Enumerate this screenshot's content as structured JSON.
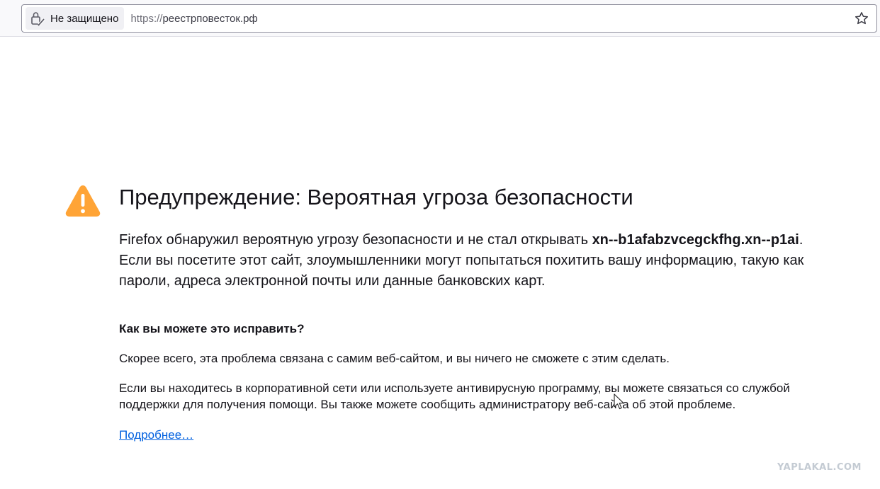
{
  "browser": {
    "identity_label": "Не защищено",
    "url_scheme": "https://",
    "url_host": "реестрповесток.рф",
    "icons": [
      "lock-warning-icon",
      "bookmark-star-icon"
    ]
  },
  "error_page": {
    "icon": "warning-triangle-icon",
    "accent_color": "#ffa436",
    "title": "Предупреждение: Вероятная угроза безопасности",
    "intro_before": "Firefox обнаружил вероятную угрозу безопасности и не стал открывать ",
    "intro_host": "xn--b1afabzvcegckfhg.xn--p1ai",
    "intro_after": ". Если вы посетите этот сайт, злоумышленники могут попытаться похитить вашу информацию, такую как пароли, адреса электронной почты или данные банковских карт.",
    "subtitle": "Как вы можете это исправить?",
    "paragraph_1": "Скорее всего, эта проблема связана с самим веб-сайтом, и вы ничего не сможете с этим сделать.",
    "paragraph_2": "Если вы находитесь в корпоративной сети или используете антивирусную программу, вы можете связаться со службой поддержки для получения помощи. Вы также можете сообщить администратору веб-сайта об этой проблеме.",
    "learn_more": "Подробнее…",
    "link_color": "#0060df"
  },
  "watermark": "YAPLAKAL.COM"
}
